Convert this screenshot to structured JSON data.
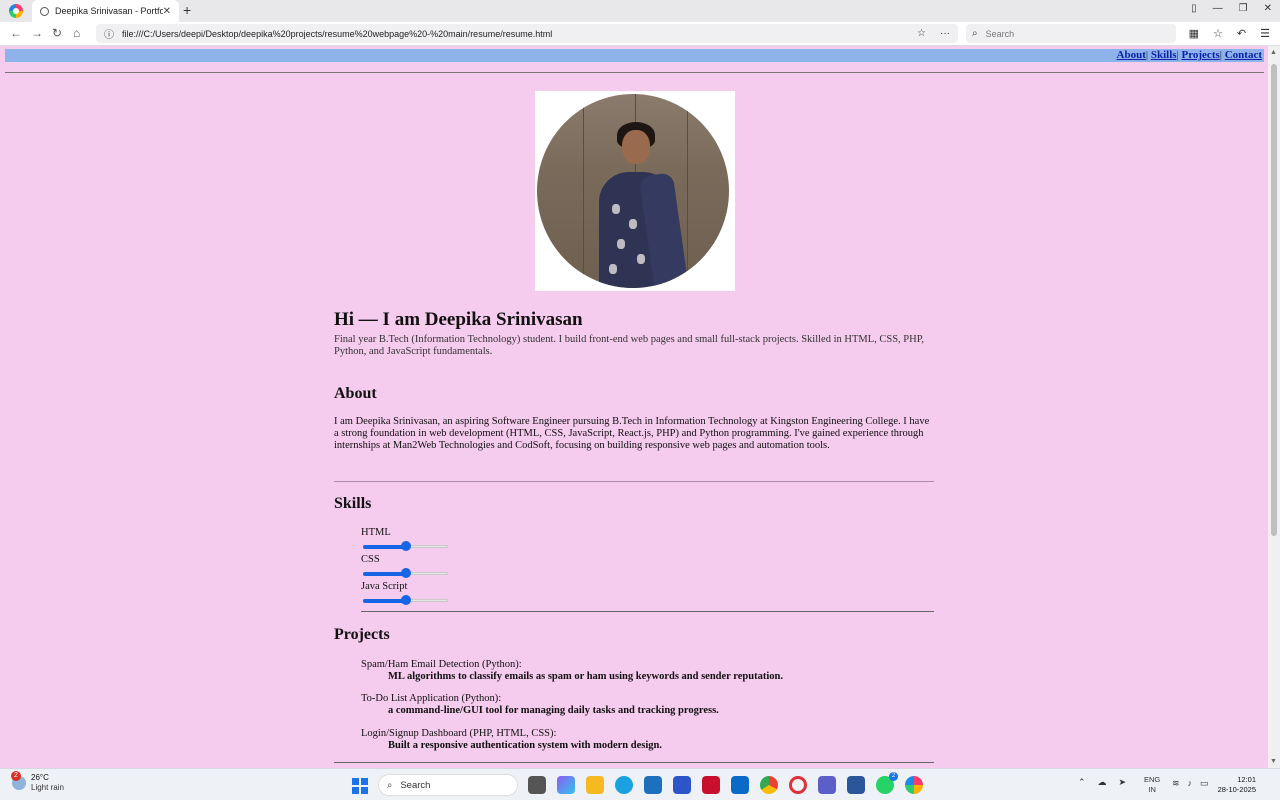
{
  "browser": {
    "tab_title": "Deepika Srinivasan - Portfolio",
    "url": "file:///C:/Users/deepi/Desktop/deepika%20projects/resume%20webpage%20-%20main/resume/resume.html",
    "search_placeholder": "Search"
  },
  "page": {
    "nav": [
      "About",
      "Skills",
      "Projects",
      "Contact"
    ],
    "nav_separator": "|",
    "hero_title": "Hi — I am Deepika Srinivasan",
    "hero_subtitle": "Final year B.Tech (Information Technology) student. I build front-end web pages and small full-stack projects. Skilled in HTML, CSS, PHP, Python, and JavaScript fundamentals.",
    "about_heading": "About",
    "about_text": "I am Deepika Srinivasan, an aspiring Software Engineer pursuing B.Tech in Information Technology at Kingston Engineering College. I have a strong foundation in web development (HTML, CSS, JavaScript, React.js, PHP) and Python programming. I've gained experience through internships at Man2Web Technologies and CodSoft, focusing on building responsive web pages and automation tools.",
    "skills_heading": "Skills",
    "skills": [
      {
        "label": "HTML",
        "level": 0.5
      },
      {
        "label": "CSS",
        "level": 0.5
      },
      {
        "label": "Java Script",
        "level": 0.5
      }
    ],
    "projects_heading": "Projects",
    "projects": [
      {
        "name": "Spam/Ham Email Detection (Python):",
        "desc": "ML algorithms to classify emails as spam or ham using keywords and sender reputation."
      },
      {
        "name": "To-Do List Application (Python):",
        "desc": "a command-line/GUI tool for managing daily tasks and tracking progress."
      },
      {
        "name": "Login/Signup Dashboard (PHP, HTML, CSS):",
        "desc": "Built a responsive authentication system with modern design."
      }
    ]
  },
  "taskbar": {
    "weather_temp": "26°C",
    "weather_desc": "Light rain",
    "weather_badge": "2",
    "search_label": "Search",
    "lang_line1": "ENG",
    "lang_line2": "IN",
    "time": "12:01",
    "date": "28-10-2025",
    "whatsapp_badge": "2",
    "app_icons": [
      "file-explorer-icon",
      "edge-icon",
      "store-icon",
      "powerautomate-icon",
      "mcafee-icon",
      "outlook-icon",
      "chrome-icon",
      "opera-icon",
      "teams-icon",
      "word-icon",
      "whatsapp-icon",
      "browser-icon"
    ]
  },
  "colors": {
    "page_bg": "#f5cbee",
    "nav_bg": "#8eb3ea",
    "slider_blue": "#1565e6"
  }
}
